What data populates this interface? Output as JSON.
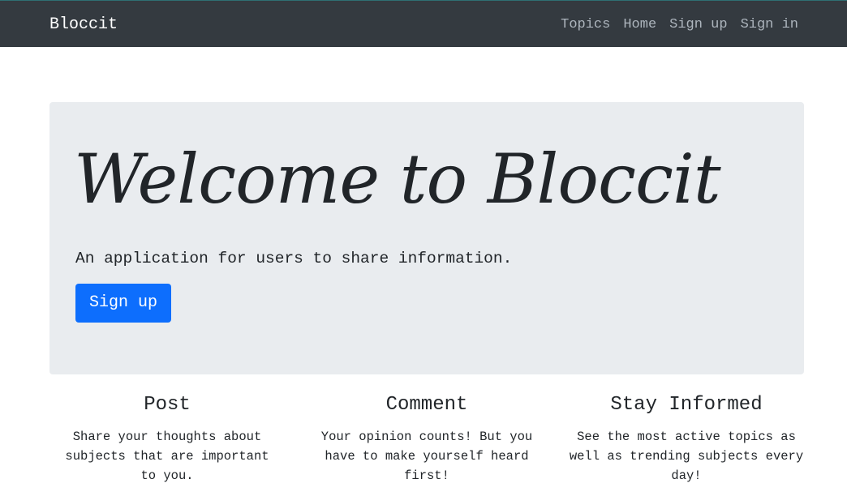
{
  "navbar": {
    "brand": "Bloccit",
    "links": [
      "Topics",
      "Home",
      "Sign up",
      "Sign in"
    ],
    "background_color": "#343a40"
  },
  "hero": {
    "title": "Welcome to Bloccit",
    "lead": "An application for users to share information.",
    "button_label": "Sign up",
    "background_color": "#e9ecef",
    "button_color": "#0d6efd"
  },
  "features": [
    {
      "title": "Post",
      "text": "Share your thoughts about subjects that are important to you."
    },
    {
      "title": "Comment",
      "text": "Your opinion counts! But you have to make yourself heard first!"
    },
    {
      "title": "Stay Informed",
      "text": "See the most active topics as well as trending subjects every day!"
    }
  ]
}
